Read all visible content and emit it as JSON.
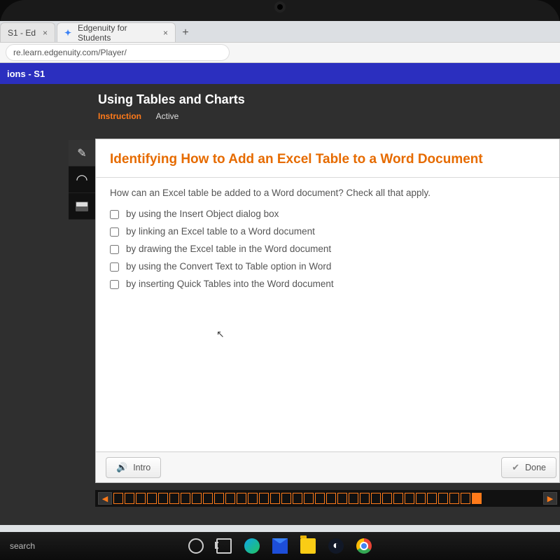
{
  "browser": {
    "tabs": [
      {
        "title": "S1 - Ed",
        "close": "×"
      },
      {
        "title": "Edgenuity for Students",
        "close": "×"
      }
    ],
    "newtab": "+",
    "url": "re.learn.edgenuity.com/Player/"
  },
  "coursebar": {
    "title": "ions - S1"
  },
  "lesson": {
    "title": "Using Tables and Charts",
    "tab_active": "Instruction",
    "tab_other": "Active"
  },
  "question": {
    "heading": "Identifying How to Add an Excel Table to a Word Document",
    "prompt": "How can an Excel table be added to a Word document? Check all that apply.",
    "options": [
      "by using the Insert Object dialog box",
      "by linking an Excel table to a Word document",
      "by drawing the Excel table in the Word document",
      "by using the Convert Text to Table option in Word",
      "by inserting Quick Tables into the Word document"
    ]
  },
  "footer": {
    "intro_label": "Intro",
    "done_label": "Done"
  },
  "progress": {
    "prev": "◀",
    "next": "▶",
    "total_cells": 33,
    "current_index": 32
  },
  "taskbar": {
    "search_placeholder": "search"
  },
  "icons": {
    "pencil": "✎",
    "headphones": "◠",
    "calculator": "⌨",
    "speaker": "🔊",
    "check": "✔"
  }
}
